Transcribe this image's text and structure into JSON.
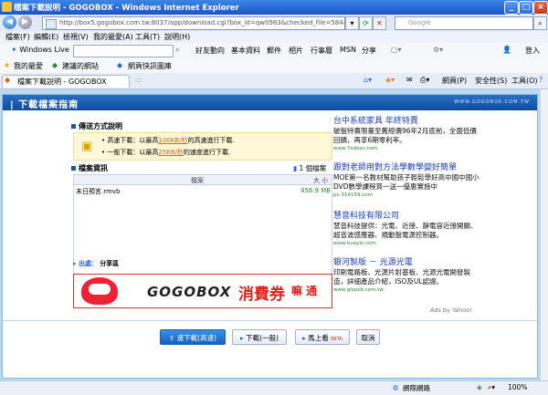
{
  "window": {
    "title": "檔案下載說明 - GOGOBOX - Windows Internet Explorer"
  },
  "address": {
    "url": "http://box5.gogobox.com.tw:8037/app/download.cgi?box_id=qw0963&checked_file=5844352&from=OUT",
    "search_placeholder": "Google"
  },
  "menu": [
    "檔案(F)",
    "編輯(E)",
    "檢視(V)",
    "我的最愛(A)",
    "工具(T)",
    "說明(H)"
  ],
  "live_toolbar": {
    "label": "Windows Live",
    "links": [
      "好友動向",
      "基本資料",
      "郵件",
      "相片",
      "行事曆",
      "MSN",
      "分享"
    ],
    "signin": "登入"
  },
  "favorites": {
    "label": "我的最愛",
    "items": [
      "建議的網站",
      "網頁快訊圖庫"
    ]
  },
  "tab": {
    "label": "檔案下載說明 - GOGOBOX"
  },
  "tab_tools": [
    "網頁(P)",
    "安全性(S)",
    "工具(O)"
  ],
  "page": {
    "header": "下載檔案指南",
    "header_url": "WWW.GOGOBOX.COM.TW",
    "method_title": "傳送方式說明",
    "method_line1": "• 高速下載：以最高",
    "method_speed1": "100KB/秒",
    "method_line1b": "的高速進行下載.",
    "method_line2": "• 一般下載：以最高",
    "method_speed2": "25KB/秒",
    "method_line2b": "的速度進行下載.",
    "files_title": "檔案資訊",
    "files_count": "1 個檔案",
    "col_file": "檔案",
    "col_size": "大 小",
    "file_name": "末日預言.rmvb",
    "file_size": "456.9 MB",
    "dest_label": "出處：",
    "dest_value": "分享區",
    "banner_brand": "GOGOBOX",
    "banner_text": "消費券",
    "banner_text2": "嘛 通"
  },
  "ads": [
    {
      "title": "台中系統家具 年終特賣",
      "body": "破盤特賣限量至舊經價96年2月底前，全面低價回饋，再享6期零利率。",
      "url": "www.7edesn.com"
    },
    {
      "title": "跟對老師用對方法學數學變好簡單",
      "body": "MOE第一名教材幫助孩子輕鬆學好高中國中國小DVD數學課程買一送一優惠實施中",
      "url": "pc-314159.com"
    },
    {
      "title": "慧音科技有限公司",
      "body": "慧音科技提供：光電、近接、靜電容近接開關、超音波感應器、規動盤電源控制器。",
      "url": "www.hueyin.com"
    },
    {
      "title": "銀河製版 － 光源光電",
      "body": "印刷電路板、光源片射基板、光源光電開發製造，詳細產品介紹，ISO及UL認證。",
      "url": "www.glxpcb.com.tw"
    }
  ],
  "ads_by": "Ads by Yahoo!",
  "buttons": {
    "fast": "速下載(高速)",
    "normal": "下載(一般)",
    "beta": "馬上看",
    "beta_tag": "BETA",
    "cancel": "取消"
  },
  "status": {
    "zone": "網際網路",
    "zoom": "100%"
  }
}
